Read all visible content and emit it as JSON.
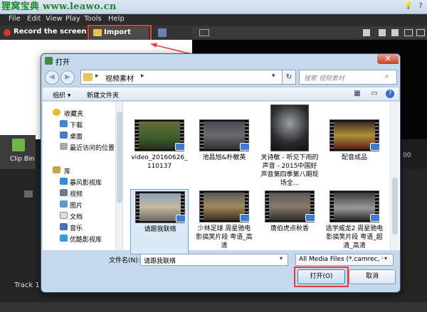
{
  "watermark": {
    "cn": "狸窝宝典",
    "url": "www.leawo.cn"
  },
  "menu": [
    "File",
    "Edit",
    "View",
    "Play",
    "Tools",
    "Help"
  ],
  "toolbar": {
    "record_label": "Record the screen",
    "import_label": "Import media"
  },
  "clip_bin_label": "Clip Bin",
  "track_label": "Track 1",
  "right_counter": "00",
  "colors": {
    "highlight": "#e33d3d",
    "record": "#d9372c",
    "watermark": "#1b8a2e"
  },
  "dialog": {
    "title": "打开",
    "close_glyph": "✕",
    "breadcrumb": "视频素材",
    "search_placeholder": "搜索 视频素材",
    "organize_label": "组织",
    "new_folder_label": "新建文件夹",
    "nav": {
      "favorites_header": "收藏夹",
      "favorites": [
        "下载",
        "桌面",
        "最近访问的位置"
      ],
      "library_header": "库",
      "libraries": [
        "暴风影视库",
        "视频",
        "图片",
        "文档",
        "音乐",
        "优酷影视库"
      ]
    },
    "files": [
      {
        "name": "video_20160626_110137",
        "selected": false
      },
      {
        "name": "池昌旭&朴敏英",
        "selected": false
      },
      {
        "name": "关诗敏 - 听见下雨的声音 - 2015中国好声音第四季第八期现场全...",
        "selected": false
      },
      {
        "name": "配音成品",
        "selected": false
      },
      {
        "name": "请跟我联络",
        "selected": true
      },
      {
        "name": "少林足球 周星驰电影搞笑片段 粤语_高清",
        "selected": false
      },
      {
        "name": "唐伯虎点秋香",
        "selected": false
      },
      {
        "name": "逃学威龙2 周星驰电影搞笑片段 粤语_超清_高清",
        "selected": false
      }
    ],
    "filename_label": "文件名(N):",
    "filename_value": "请跟我联络",
    "filter_value": "All Media Files (*.camrec, *.a",
    "open_label": "打开(O)",
    "cancel_label": "取消"
  }
}
